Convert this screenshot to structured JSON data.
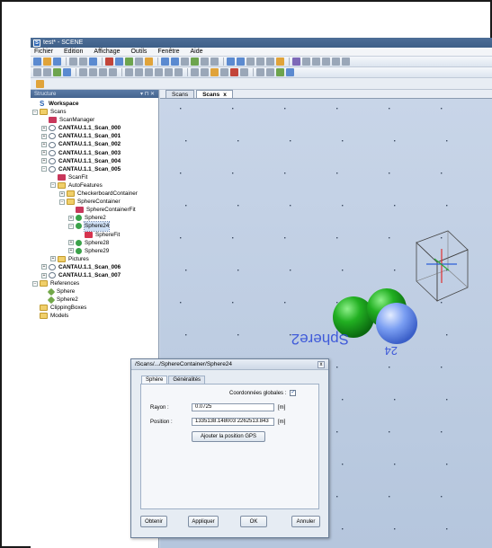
{
  "window": {
    "title": "test* - SCENE"
  },
  "menu": [
    "Fichier",
    "Edition",
    "Affichage",
    "Outils",
    "Fenêtre",
    "Aide"
  ],
  "structure": {
    "title": "Structure",
    "controls": "▾ ⊓ ✕"
  },
  "tabs": [
    {
      "label": "Scans"
    },
    {
      "label": "Scans",
      "close": "x"
    }
  ],
  "tree": [
    {
      "label": "Workspace",
      "level": 0,
      "icon": "workspace",
      "bold": true,
      "exp": ""
    },
    {
      "label": "Scans",
      "level": 0,
      "icon": "folder",
      "exp": "−"
    },
    {
      "label": "ScanManager",
      "level": 1,
      "icon": "manager",
      "exp": ""
    },
    {
      "label": "CANTAU.1.1_Scan_000",
      "level": 1,
      "icon": "scan",
      "bold": true,
      "exp": "+"
    },
    {
      "label": "CANTAU.1.1_Scan_001",
      "level": 1,
      "icon": "scan",
      "bold": true,
      "exp": "+"
    },
    {
      "label": "CANTAU.1.1_Scan_002",
      "level": 1,
      "icon": "scan",
      "bold": true,
      "exp": "+"
    },
    {
      "label": "CANTAU.1.1_Scan_003",
      "level": 1,
      "icon": "scan",
      "bold": true,
      "exp": "+"
    },
    {
      "label": "CANTAU.1.1_Scan_004",
      "level": 1,
      "icon": "scan",
      "bold": true,
      "exp": "+"
    },
    {
      "label": "CANTAU.1.1_Scan_005",
      "level": 1,
      "icon": "scan",
      "bold": true,
      "exp": "−"
    },
    {
      "label": "ScanFit",
      "level": 2,
      "icon": "manager",
      "exp": ""
    },
    {
      "label": "AutoFeatures",
      "level": 2,
      "icon": "folder",
      "exp": "−"
    },
    {
      "label": "CheckerboardContainer",
      "level": 3,
      "icon": "folder",
      "exp": "+"
    },
    {
      "label": "SphereContainer",
      "level": 3,
      "icon": "folder",
      "exp": "−"
    },
    {
      "label": "SphereContainerFit",
      "level": 4,
      "icon": "manager",
      "exp": ""
    },
    {
      "label": "Sphere2",
      "level": 4,
      "icon": "sphere",
      "exp": "+"
    },
    {
      "label": "Sphere24",
      "level": 4,
      "icon": "sphere",
      "exp": "−",
      "selected": true
    },
    {
      "label": "SphereFit",
      "level": 5,
      "icon": "spherefit",
      "exp": ""
    },
    {
      "label": "Sphere28",
      "level": 4,
      "icon": "sphere",
      "exp": "+"
    },
    {
      "label": "Sphere29",
      "level": 4,
      "icon": "sphere",
      "exp": "+"
    },
    {
      "label": "Pictures",
      "level": 2,
      "icon": "folder",
      "exp": "+"
    },
    {
      "label": "CANTAU.1.1_Scan_006",
      "level": 1,
      "icon": "scan",
      "bold": true,
      "exp": "+"
    },
    {
      "label": "CANTAU.1.1_Scan_007",
      "level": 1,
      "icon": "scan",
      "bold": true,
      "exp": "+"
    },
    {
      "label": "References",
      "level": 0,
      "icon": "folder",
      "exp": "−"
    },
    {
      "label": "Sphere",
      "level": 1,
      "icon": "reference",
      "exp": ""
    },
    {
      "label": "Sphere2",
      "level": 1,
      "icon": "reference",
      "exp": ""
    },
    {
      "label": "ClippingBoxes",
      "level": 0,
      "icon": "folder",
      "exp": ""
    },
    {
      "label": "Models",
      "level": 0,
      "icon": "folder",
      "exp": ""
    }
  ],
  "viewport": {
    "sphere_label_1": "Sphere2",
    "sphere_label_2": "24"
  },
  "dialog": {
    "title": "/Scans/.../SphereContainer/Sphere24",
    "close": "x",
    "tabs": [
      "Sphère",
      "Généralités"
    ],
    "global_coords_label": "Coordonnées globales :",
    "global_coords_checked": "✓",
    "radius_label": "Rayon :",
    "radius_value": "0.0725",
    "radius_unit": "[m]",
    "position_label": "Position :",
    "position_value": "1335138.148003 2262513.843",
    "position_unit": "[m]",
    "gps_button": "Ajouter la position GPS",
    "buttons": {
      "obtain": "Obtenir",
      "apply": "Appliquer",
      "ok": "OK",
      "cancel": "Annuler"
    }
  },
  "colors": {
    "titlebar": "#45658f",
    "viewport_bg": "#c0cfe3",
    "sphere_green": "#22b022",
    "sphere_blue": "#7a9ef2"
  }
}
